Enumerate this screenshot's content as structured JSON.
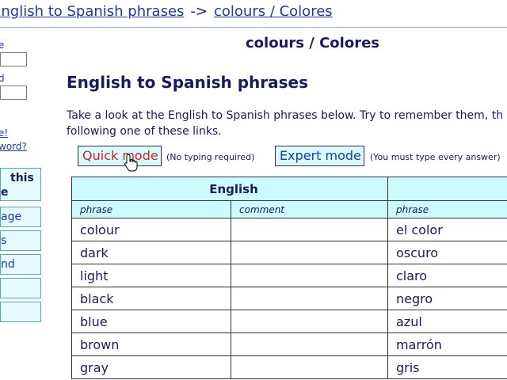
{
  "breadcrumb": {
    "crumb1": "English to Spanish phrases",
    "separator": "->",
    "crumb2": "colours / Colores"
  },
  "sidebar": {
    "label1": "e",
    "label2": "d",
    "link1": "e!",
    "link2": "word?",
    "box1_line1": "this",
    "box1_line2": "e",
    "box2": "age",
    "box3": "s",
    "box4": "nd",
    "box5": "",
    "box6": ""
  },
  "page_title": "colours / Colores",
  "section_title": "English to Spanish phrases",
  "intro": {
    "line1": "Take a look at the English to Spanish phrases below. Try to remember them, th",
    "line2": "following one of these links."
  },
  "modes": {
    "quick_label": "Quick mode",
    "quick_note": "(No typing required)",
    "expert_label": "Expert mode",
    "expert_note": "(You must type every answer)"
  },
  "table": {
    "group_english": "English",
    "group_spanish": "",
    "col_phrase": "phrase",
    "col_comment": "comment",
    "col_phrase2": "phrase",
    "rows": [
      {
        "en": "colour",
        "comment": "",
        "es": "el color"
      },
      {
        "en": "dark",
        "comment": "",
        "es": "oscuro"
      },
      {
        "en": "light",
        "comment": "",
        "es": "claro"
      },
      {
        "en": "black",
        "comment": "",
        "es": "negro"
      },
      {
        "en": "blue",
        "comment": "",
        "es": "azul"
      },
      {
        "en": "brown",
        "comment": "",
        "es": "marrón"
      },
      {
        "en": "gray",
        "comment": "",
        "es": "gris"
      }
    ]
  },
  "icons": {
    "cursor": "hand-pointer-icon"
  }
}
